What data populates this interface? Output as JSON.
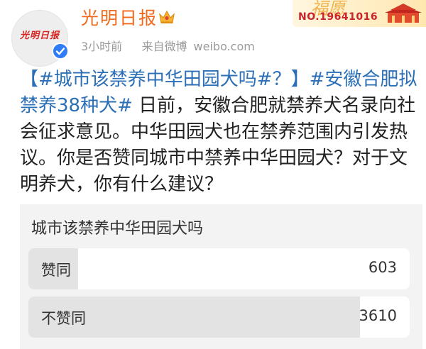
{
  "user": {
    "name": "光明日报",
    "avatar_text": "光明日报",
    "time": "3小时前",
    "source": "来自微博 weibo.com",
    "banner_number": "NO.19641016",
    "banner_deco": "福愿"
  },
  "post": {
    "tag1": "【#城市该禁养中华田园犬吗#？】",
    "tag2": "#安徽合肥拟禁养38种犬#",
    "body": " 日前，安徽合肥就禁养犬名录向社会征求意见。中华田园犬也在禁养范围内引发热议。你是否赞同城市中禁养中华田园犬？对于文明养犬，你有什么建议？"
  },
  "poll": {
    "title": "城市该禁养中华田园犬吗",
    "options": [
      {
        "label": "赞同",
        "count": "603",
        "fraction": 0.13
      },
      {
        "label": "不赞同",
        "count": "3610",
        "fraction": 0.87
      }
    ]
  },
  "colors": {
    "name": "#f06a1e",
    "hashtag": "#2b6fb6",
    "verified": "#2e7df6",
    "poll_bg": "#f3f3f3",
    "poll_fill": "#e3e3e3"
  },
  "icons": {
    "crown": "crown-icon",
    "verified": "verified-check-icon"
  }
}
